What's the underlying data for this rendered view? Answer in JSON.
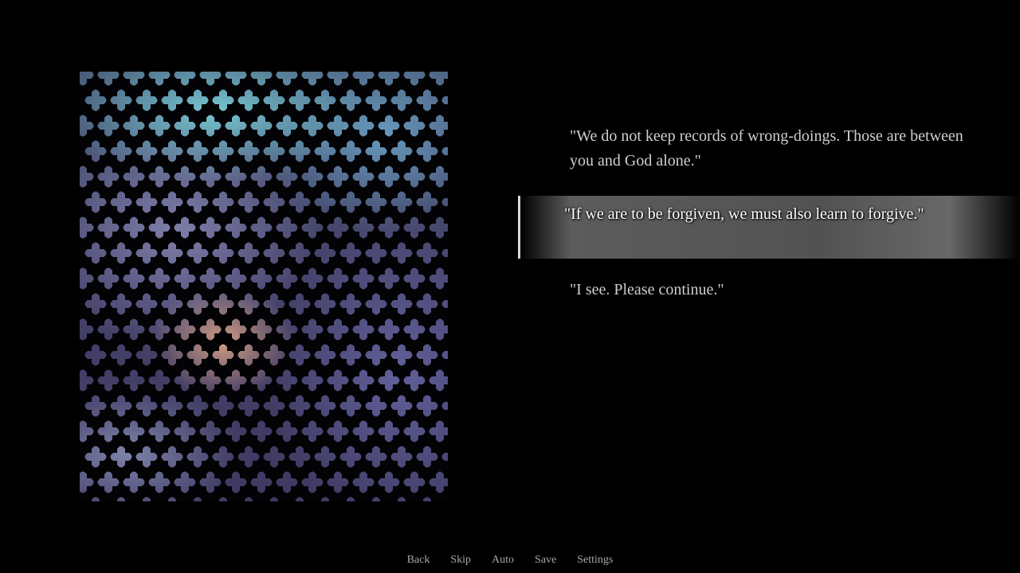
{
  "dialogue": {
    "history": [
      {
        "text": "\"We do not keep records of wrong-doings. Those are between you and God alone.\""
      },
      {
        "text": "\"If we are to be forgiven, we must also learn to forgive.\""
      },
      {
        "text": "\"I see. Please continue.\""
      }
    ],
    "current_index": 1
  },
  "quick_menu": {
    "back": "Back",
    "skip": "Skip",
    "auto": "Auto",
    "save": "Save",
    "settings": "Settings"
  },
  "scene": {
    "image": "confessional-lattice",
    "colors": {
      "background": "#000000",
      "lattice_teal": "#78cdd7",
      "lattice_violet": "#6e6eaf",
      "lattice_skin": "#d7a082",
      "highlight_bar": "#5c5c5c"
    }
  }
}
